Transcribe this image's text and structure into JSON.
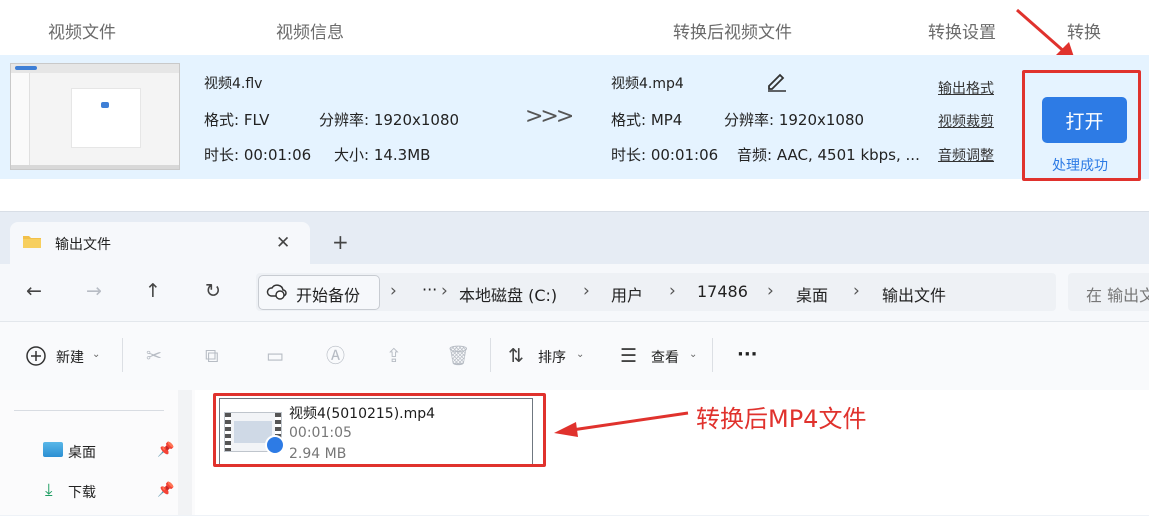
{
  "converter": {
    "headers": [
      "视频文件",
      "视频信息",
      "转换后视频文件",
      "转换设置",
      "转换"
    ],
    "source": {
      "name": "视频4.flv",
      "format": "格式: FLV",
      "resolution": "分辨率: 1920x1080",
      "duration": "时长: 00:01:06",
      "size": "大小: 14.3MB"
    },
    "arrow_text": ">>>",
    "output": {
      "name": "视频4.mp4",
      "format": "格式: MP4",
      "resolution": "分辨率: 1920x1080",
      "duration": "时长: 00:01:06",
      "audio": "音频: AAC, 4501 kbps, ..."
    },
    "settings_links": [
      "输出格式",
      "视频裁剪",
      "音频调整"
    ],
    "open_button": "打开",
    "status": "处理成功",
    "colors": {
      "row_bg": "#e5f3ff",
      "accent": "#2d7be5",
      "highlight": "#e0322d"
    }
  },
  "explorer": {
    "tab_title": "输出文件",
    "new_tab_symbol": "+",
    "backup_label": "开始备份",
    "ellipsis": "···",
    "breadcrumb": [
      "本地磁盘 (C:)",
      "用户",
      "17486",
      "桌面",
      "输出文件"
    ],
    "search_placeholder": "在 输出文",
    "toolbar": {
      "new_label": "新建",
      "sort_label": "排序",
      "view_label": "查看",
      "more_label": "···"
    },
    "nav_items": [
      {
        "label": "桌面",
        "icon": "desktop-icon"
      },
      {
        "label": "下载",
        "icon": "download-icon"
      }
    ],
    "file": {
      "name": "视频4(5010215).mp4",
      "duration": "00:01:05",
      "size": "2.94 MB"
    }
  },
  "annotation": {
    "text": "转换后MP4文件"
  }
}
